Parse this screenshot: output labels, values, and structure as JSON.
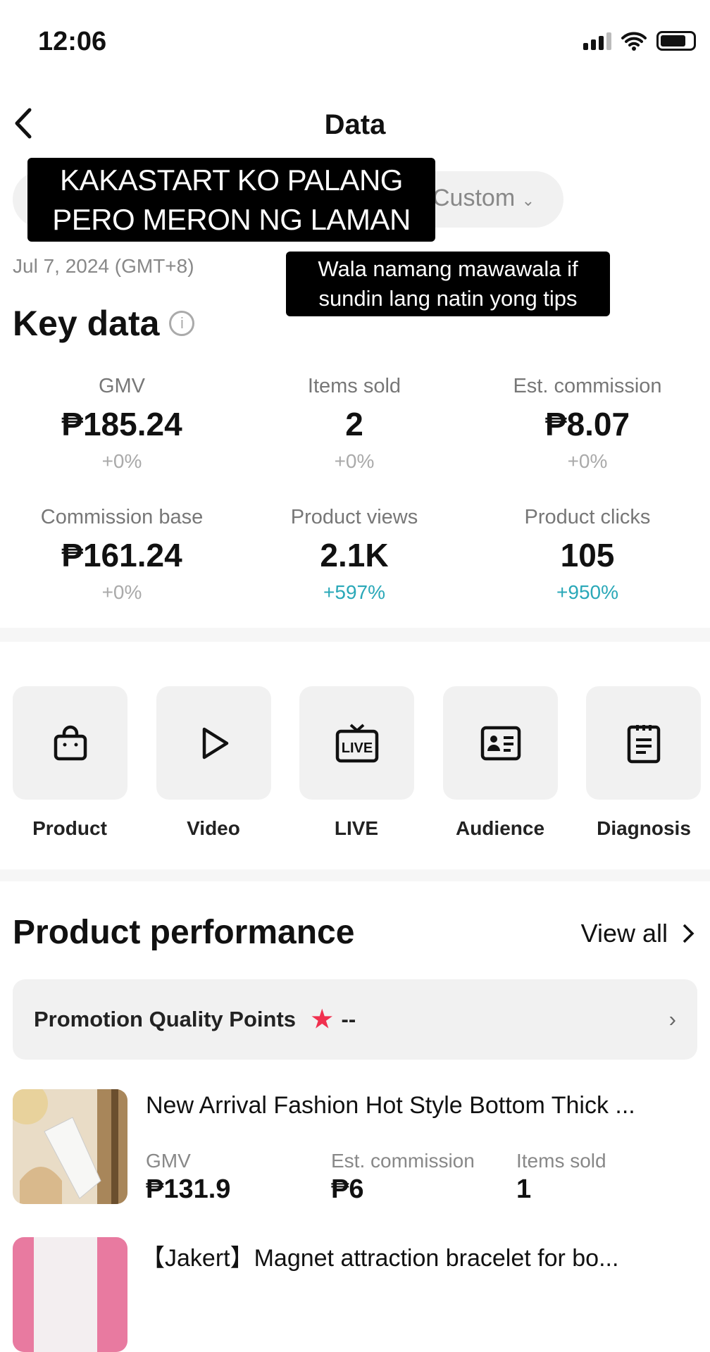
{
  "status_bar": {
    "time": "12:06"
  },
  "header": {
    "title": "Data",
    "back_icon": "chevron-left-icon"
  },
  "date_filter": {
    "selected": "Custom",
    "date": "Jul 7, 2024 (GMT+8)"
  },
  "captions": {
    "top": [
      "KAKASTART KO PALANG",
      "PERO MERON NG LAMAN"
    ],
    "middle": [
      "Wala namang mawawala if",
      "sundin lang natin yong tips"
    ]
  },
  "key_data": {
    "title": "Key data",
    "metrics": [
      {
        "label": "GMV",
        "value": "₱185.24",
        "change": "+0%"
      },
      {
        "label": "Items sold",
        "value": "2",
        "change": "+0%"
      },
      {
        "label": "Est. commission",
        "value": "₱8.07",
        "change": "+0%"
      },
      {
        "label": "Commission base",
        "value": "₱161.24",
        "change": "+0%"
      },
      {
        "label": "Product views",
        "value": "2.1K",
        "change": "+597%"
      },
      {
        "label": "Product clicks",
        "value": "105",
        "change": "+950%"
      }
    ]
  },
  "shortcuts": [
    {
      "label": "Product",
      "icon": "shopping-bag-icon"
    },
    {
      "label": "Video",
      "icon": "play-icon"
    },
    {
      "label": "LIVE",
      "icon": "live-tv-icon"
    },
    {
      "label": "Audience",
      "icon": "id-card-icon"
    },
    {
      "label": "Diagnosis",
      "icon": "clipboard-icon"
    }
  ],
  "product_performance": {
    "title": "Product performance",
    "view_all": "View all",
    "promotion": {
      "label": "Promotion Quality Points",
      "value": "--"
    },
    "products": [
      {
        "title": "New Arrival Fashion Hot Style Bottom Thick ...",
        "gmv_label": "GMV",
        "gmv": "₱131.9",
        "commission_label": "Est. commission",
        "commission": "₱6",
        "sold_label": "Items sold",
        "sold": "1"
      },
      {
        "title": "【Jakert】Magnet attraction bracelet for bo..."
      }
    ]
  },
  "colors": {
    "accent_up": "#2aa8b8",
    "star": "#f0304e"
  }
}
